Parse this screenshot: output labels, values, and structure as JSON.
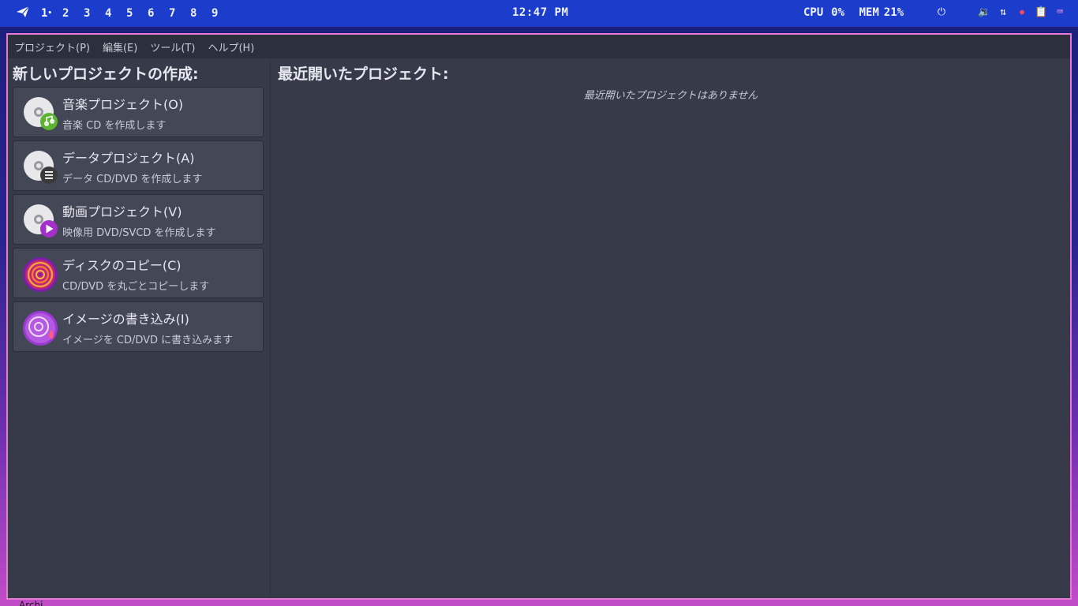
{
  "topbar": {
    "workspaces": [
      "1",
      "2",
      "3",
      "4",
      "5",
      "6",
      "7",
      "8",
      "9"
    ],
    "active_workspace_marker": "•",
    "clock": "12:47 PM",
    "cpu_label": "CPU",
    "cpu_value": "0%",
    "mem_label": "MEM",
    "mem_value": "21%",
    "icons": [
      "launcher-icon",
      "power-icon",
      "volume-icon",
      "network-icon",
      "bug-icon",
      "clipboard-icon",
      "keyboard-icon"
    ]
  },
  "menubar": {
    "items": [
      "プロジェクト(P)",
      "編集(E)",
      "ツール(T)",
      "ヘルプ(H)"
    ]
  },
  "sidebar": {
    "title": "新しいプロジェクトの作成:",
    "projects": [
      {
        "title": "音楽プロジェクト(O)",
        "desc": "音楽 CD を作成します",
        "icon": "audio-disc-icon",
        "color": "#5cb531"
      },
      {
        "title": "データプロジェクト(A)",
        "desc": "データ CD/DVD を作成します",
        "icon": "data-disc-icon",
        "color": "#3a3a3a"
      },
      {
        "title": "動画プロジェクト(V)",
        "desc": "映像用 DVD/SVCD を作成します",
        "icon": "video-disc-icon",
        "color": "#a530c9"
      },
      {
        "title": "ディスクのコピー(C)",
        "desc": "CD/DVD を丸ごとコピーします",
        "icon": "disc-copy-icon",
        "color": "#e0358a"
      },
      {
        "title": "イメージの書き込み(I)",
        "desc": "イメージを CD/DVD に書き込みます",
        "icon": "image-burn-icon",
        "color": "#c44be0"
      }
    ]
  },
  "main": {
    "title": "最近開いたプロジェクト:",
    "empty_text": "最近開いたプロジェクトはありません"
  },
  "bottom": {
    "text": "Archi"
  }
}
